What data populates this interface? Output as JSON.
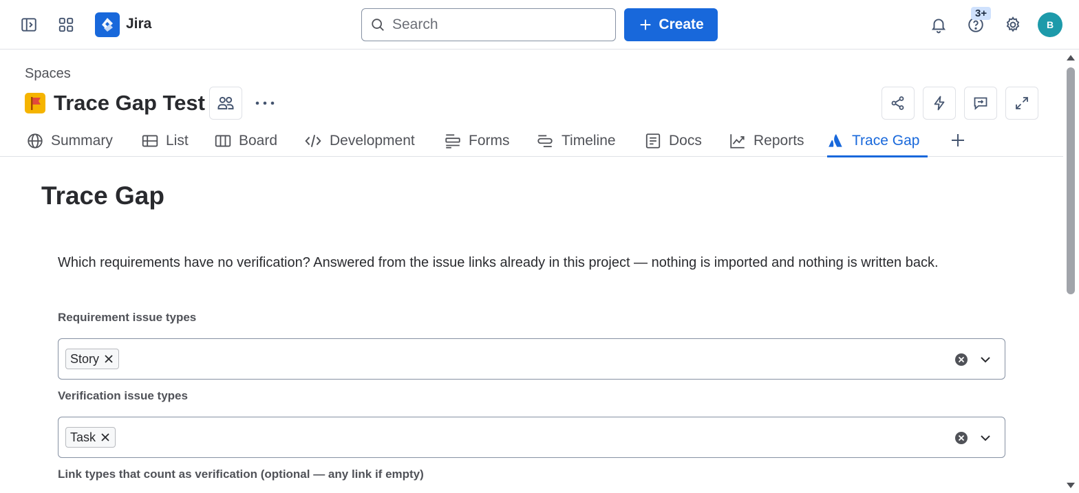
{
  "topnav": {
    "app_name": "Jira",
    "search_placeholder": "Search",
    "create_label": "Create",
    "help_badge": "3+",
    "avatar_initial": "B"
  },
  "project": {
    "breadcrumb": "Spaces",
    "title": "Trace Gap Test",
    "more_label": "···"
  },
  "tabs": [
    {
      "label": "Summary",
      "icon": "globe-icon"
    },
    {
      "label": "List",
      "icon": "list-icon"
    },
    {
      "label": "Board",
      "icon": "board-icon"
    },
    {
      "label": "Development",
      "icon": "code-icon"
    },
    {
      "label": "Forms",
      "icon": "forms-icon"
    },
    {
      "label": "Timeline",
      "icon": "timeline-icon"
    },
    {
      "label": "Docs",
      "icon": "docs-icon"
    },
    {
      "label": "Reports",
      "icon": "reports-icon"
    },
    {
      "label": "Trace Gap",
      "icon": "app-icon",
      "active": true
    }
  ],
  "content": {
    "title": "Trace Gap",
    "description": "Which requirements have no verification? Answered from the issue links already in this project — nothing is imported and nothing is written back.",
    "fields": [
      {
        "label": "Requirement issue types",
        "chips": [
          "Story"
        ]
      },
      {
        "label": "Verification issue types",
        "chips": [
          "Task"
        ]
      },
      {
        "label": "Link types that count as verification (optional — any link if empty)"
      }
    ]
  },
  "colors": {
    "brand": "#1868db",
    "avatar": "#1d9aaa",
    "project_icon": "#f5b400"
  }
}
